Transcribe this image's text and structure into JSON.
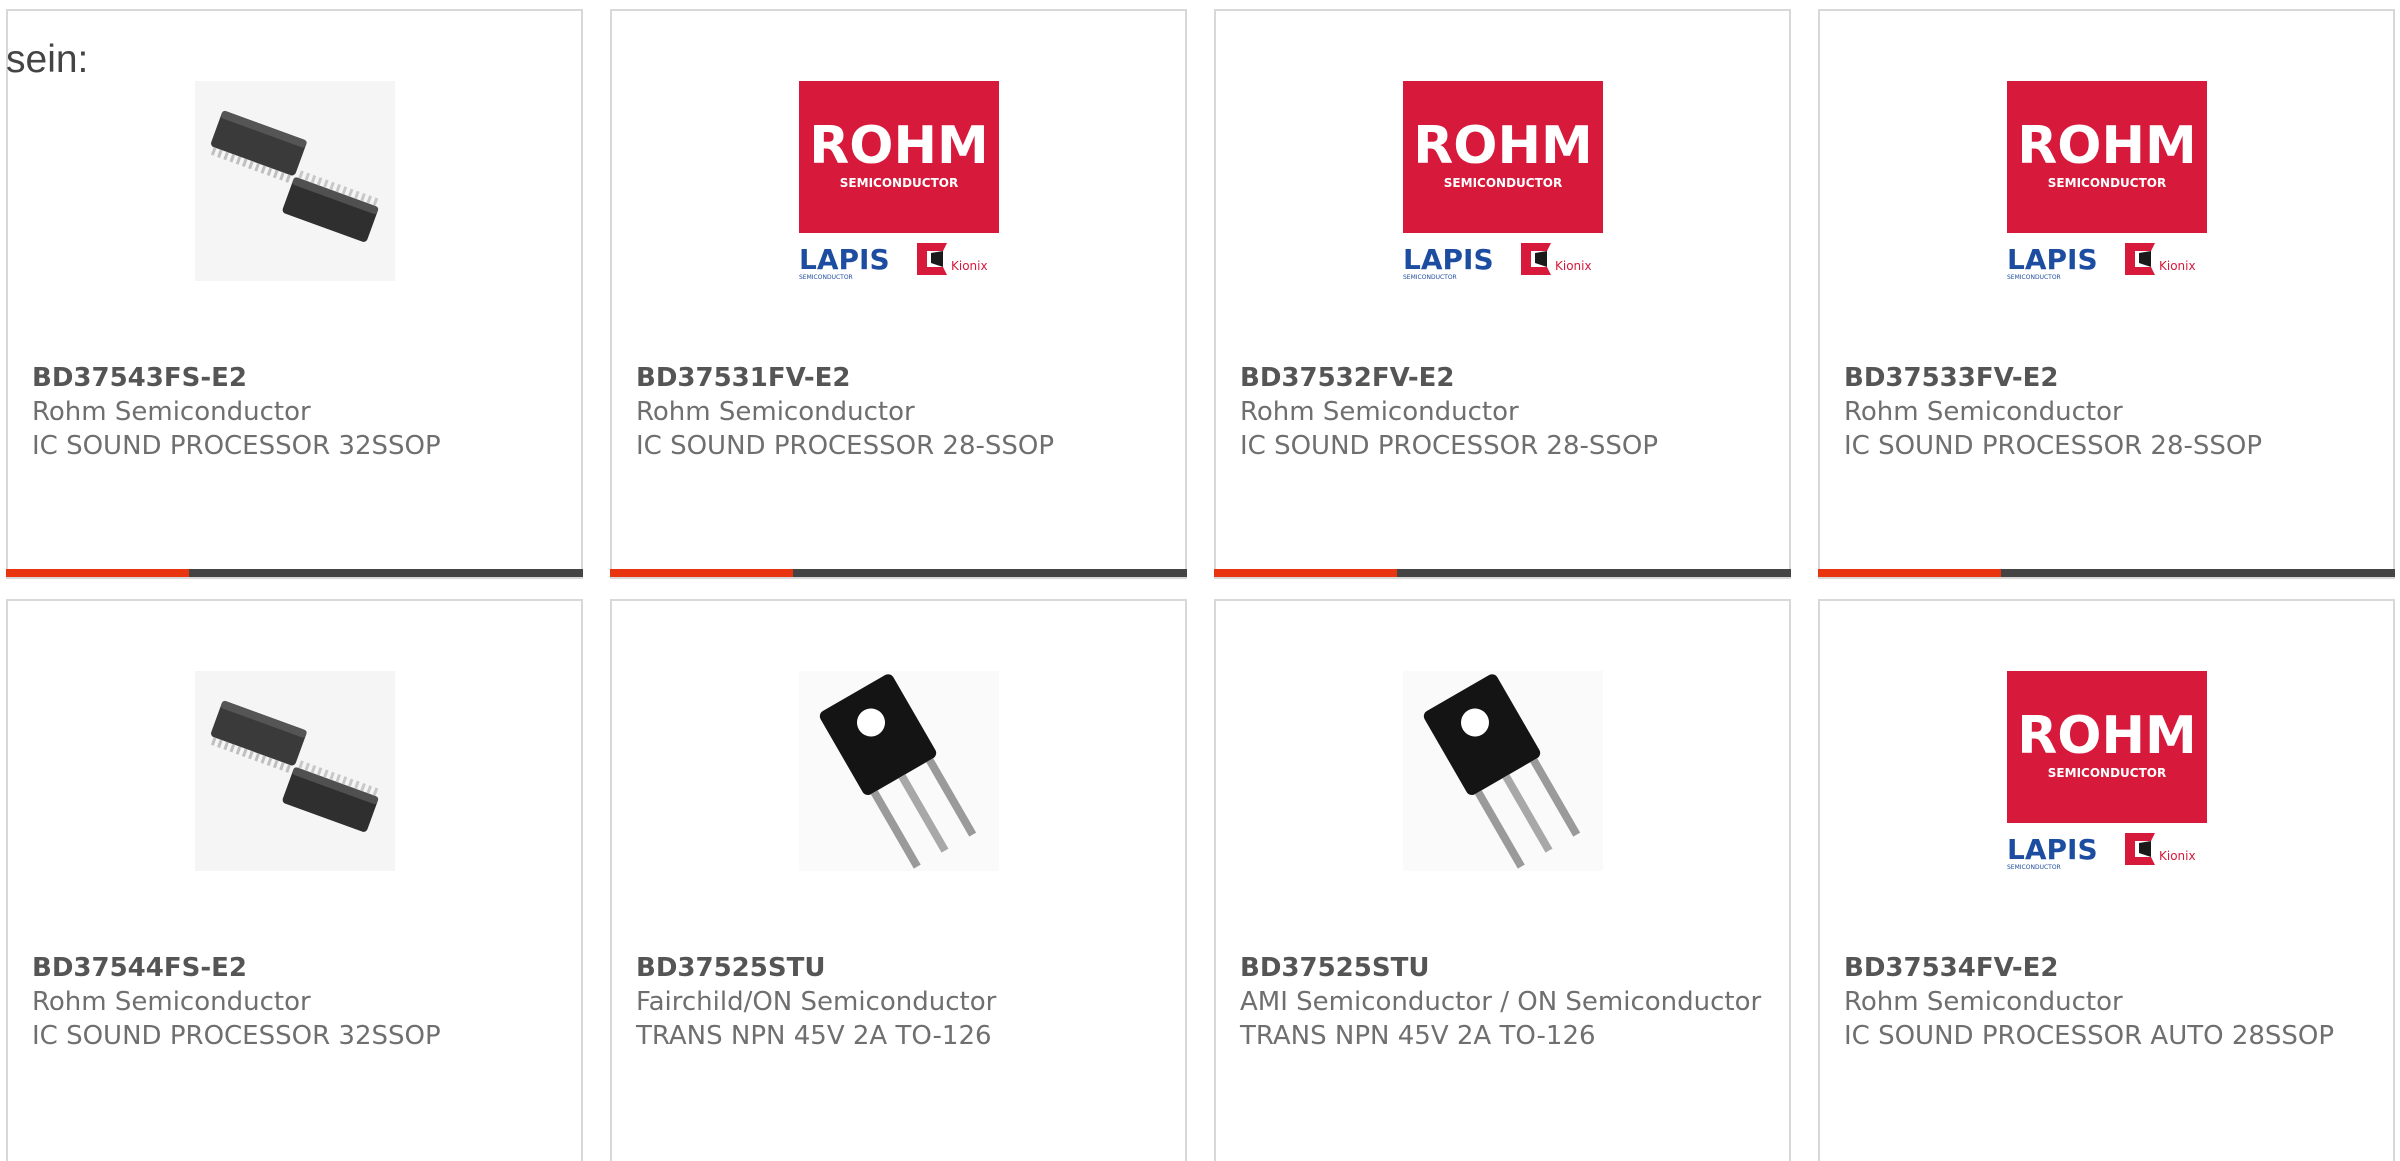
{
  "intro_text": "sein:",
  "colors": {
    "accent": "#e8350f",
    "bar": "#444444",
    "rohm_red": "#d7193c",
    "lapis_blue": "#1d4da0"
  },
  "logo_text": {
    "rohm": "ROHM",
    "semiconductor": "SEMICONDUCTOR",
    "lapis": "LAPIS",
    "lapis_sub": "SEMICONDUCTOR",
    "kionix": "Kionix"
  },
  "products": [
    {
      "part": "BD37543FS-E2",
      "manufacturer": "Rohm Semiconductor",
      "description": "IC SOUND PROCESSOR 32SSOP",
      "image": "ssop-chip-icon"
    },
    {
      "part": "BD37531FV-E2",
      "manufacturer": "Rohm Semiconductor",
      "description": "IC SOUND PROCESSOR 28-SSOP",
      "image": "rohm-logo"
    },
    {
      "part": "BD37532FV-E2",
      "manufacturer": "Rohm Semiconductor",
      "description": "IC SOUND PROCESSOR 28-SSOP",
      "image": "rohm-logo"
    },
    {
      "part": "BD37533FV-E2",
      "manufacturer": "Rohm Semiconductor",
      "description": "IC SOUND PROCESSOR 28-SSOP",
      "image": "rohm-logo"
    },
    {
      "part": "BD37544FS-E2",
      "manufacturer": "Rohm Semiconductor",
      "description": "IC SOUND PROCESSOR 32SSOP",
      "image": "ssop-chip-icon"
    },
    {
      "part": "BD37525STU",
      "manufacturer": "Fairchild/ON Semiconductor",
      "description": "TRANS NPN 45V 2A TO-126",
      "image": "to126-transistor-icon"
    },
    {
      "part": "BD37525STU",
      "manufacturer": "AMI Semiconductor / ON Semiconductor",
      "description": "TRANS NPN 45V 2A TO-126",
      "image": "to126-transistor-icon"
    },
    {
      "part": "BD37534FV-E2",
      "manufacturer": "Rohm Semiconductor",
      "description": "IC SOUND PROCESSOR AUTO 28SSOP",
      "image": "rohm-logo"
    }
  ]
}
